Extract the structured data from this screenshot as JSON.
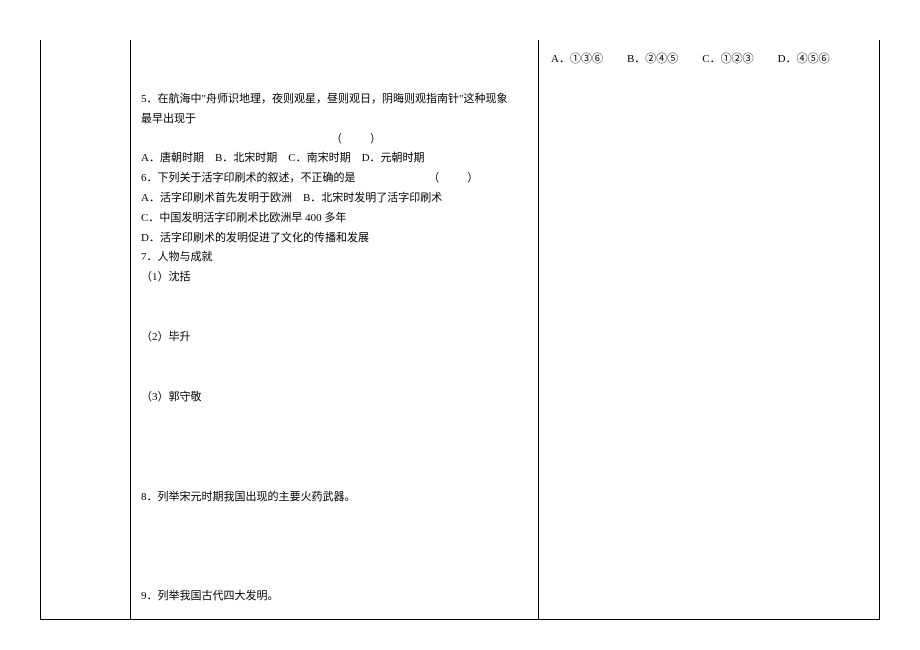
{
  "right": {
    "optA": "A．①③⑥",
    "optB": "B．②④⑤",
    "optC": "C．①②③",
    "optD": "D．④⑤⑥"
  },
  "mid": {
    "q5_line1": "5．在航海中\"舟师识地理，夜则观星，昼则观日，阴晦则观指南针\"这种现象最早出现于",
    "q5_line2": "（　　）",
    "q5_opts": "A．唐朝时期　B．北宋时期　C．南宋时期　D．元朝时期",
    "q6_line": "6．下列关于活字印刷术的叙述，不正确的是",
    "q6_paren": "（　　）",
    "q6_optA": "A．活字印刷术首先发明于欧洲　B．北宋时发明了活字印刷术",
    "q6_optC": "C．中国发明活字印刷术比欧洲早 400 多年",
    "q6_optD": "D．活字印刷术的发明促进了文化的传播和发展",
    "q7": "7．人物与成就",
    "q7_1": "（1）沈括",
    "q7_2": "（2）毕升",
    "q7_3": "（3）郭守敬",
    "q8": "8．列举宋元时期我国出现的主要火药武器。",
    "q9": "9．列举我国古代四大发明。"
  }
}
